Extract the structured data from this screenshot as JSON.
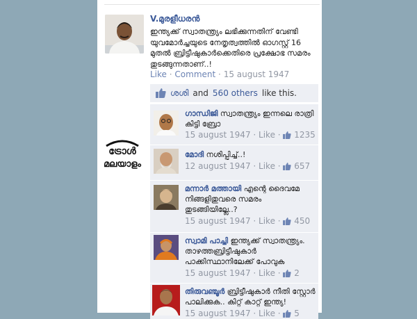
{
  "post": {
    "author": "V.മുരളീധരൻ",
    "text": "ഇന്ത്യക്ക് സ്വാതന്ത്ര്യം ലഭിക്കുന്നതിന് വേണ്ടി യുവമോർച്ചയുടെ നേതൃത്വത്തിൽ ഓഗസ്റ്റ് 16 മുതൽ ബ്രിട്ടീഷുകാർക്കെതിരെ പ്രക്ഷോഭ സമരം തുടങ്ങുന്നതാണ്..!",
    "like_label": "Like",
    "sep": "·",
    "comment_label": "Comment",
    "date": "15 august 1947"
  },
  "likes": {
    "liker": "ശശി",
    "and_text": "and",
    "others": "560 others",
    "suffix": "like this."
  },
  "comments": [
    {
      "name": "ഗാന്ധിജി",
      "text": "സ്വാതന്ത്ര്യം ഇന്നലെ രാത്രി കിട്ടി ബ്രോ",
      "date": "15 august 1947",
      "like_label": "Like",
      "count": "1235"
    },
    {
      "name": "മോദി",
      "text": "നശിപ്പിച്ച്..!",
      "date": "12 august 1947",
      "like_label": "Like",
      "count": "657"
    },
    {
      "name": "മന്നാർ മത്തായി",
      "text": "എന്റെ ദൈവമേ നിങ്ങളിതുവരെ സമരം തുടങ്ങിയില്ലേ..?",
      "date": "15 august 1947",
      "like_label": "Like",
      "count": "450"
    },
    {
      "name": "സ്വാമി പാച്ചി",
      "text": "ഇന്ത്യക്ക് സ്വാതന്ത്ര്യം. താഴത്തബ്രിട്ടീഷുകാർ പാക്കിസ്ഥാനിലേക്ക് പോവുക",
      "date": "15 august 1947",
      "like_label": "Like",
      "count": "2"
    },
    {
      "name": "തിരുവഞ്ചൂർ",
      "text": "ബ്രിട്ടീഷുകാർ നീതി സ്റ്റോർ പാലിക്കുക.. കിറ്റ് കാറ്റ് ഇന്ത്യ!",
      "date": "15 august 1947",
      "like_label": "Like",
      "count": "5"
    }
  ],
  "logo": {
    "line1": "ട്രോൾ",
    "line2": "മലയാളം"
  },
  "colors": {
    "background": "#8ea8b6",
    "link": "#3b5998",
    "comment_bg": "#edeff4",
    "meta": "#9197a3"
  }
}
